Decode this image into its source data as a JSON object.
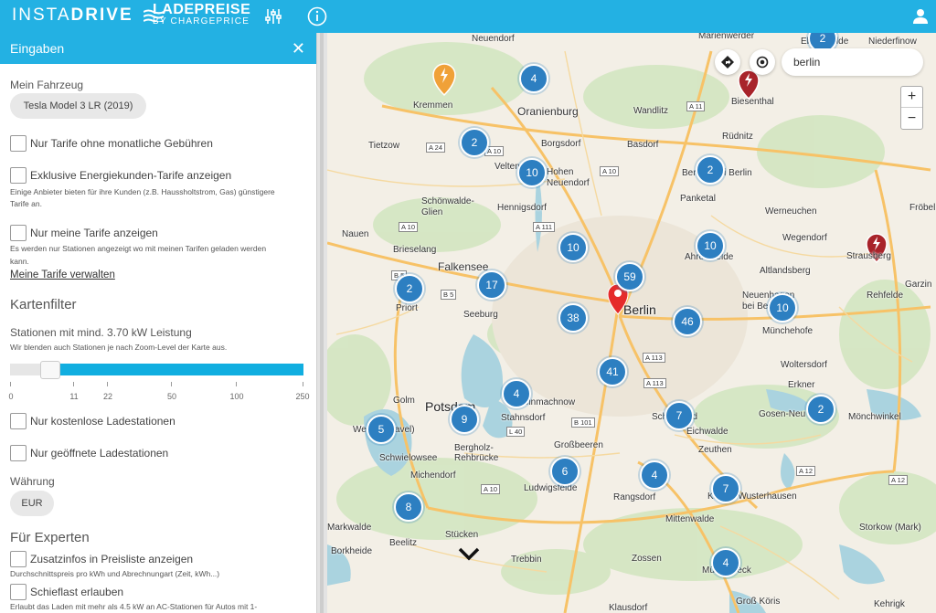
{
  "brand": {
    "insta_light": "INSTA",
    "insta_bold": "DRIVE",
    "lade_big": "LADEPREISE",
    "lade_small": "BY CHARGEPRICE"
  },
  "topbar": {
    "settings_icon": "sliders-icon",
    "info_icon": "info-icon",
    "user_icon": "user-icon"
  },
  "sidebar": {
    "title": "Eingaben",
    "vehicle_label": "Mein Fahrzeug",
    "vehicle_value": "Tesla Model 3 LR (2019)",
    "chk_no_monthly": "Nur Tarife ohne monatliche Gebühren",
    "chk_exclusive": "Exklusive Energiekunden-Tarife anzeigen",
    "hint_exclusive_1": "Einige Anbieter bieten für ihre Kunden (z.B. Haussholtstrom, Gas) günstigere",
    "hint_exclusive_2": "Tarife an.",
    "chk_my_tariffs": "Nur meine Tarife anzeigen",
    "hint_my_tariffs_1": "Es werden nur Stationen angezeigt wo mit meinen Tarifen geladen werden",
    "hint_my_tariffs_2": "kann.",
    "manage_link": "Meine Tarife verwalten",
    "map_filter_title": "Kartenfilter",
    "min_power_label": "Stationen mit mind. 3.70 kW Leistung",
    "min_power_hint": "Wir blenden auch Stationen je nach Zoom-Level der Karte aus.",
    "slider_ticks": [
      "0",
      "11",
      "22",
      "50",
      "100",
      "250"
    ],
    "slider_value_kw": 3.7,
    "chk_free": "Nur kostenlose Ladestationen",
    "chk_open": "Nur geöffnete Ladestationen",
    "currency_label": "Währung",
    "currency_value": "EUR",
    "experts_title": "Für Experten",
    "chk_extra_info": "Zusatzinfos in Preisliste anzeigen",
    "hint_extra_info": "Durchschnittspreis pro kWh und Abrechnungart (Zeit, kWh...)",
    "chk_unbalanced": "Schieflast erlauben",
    "hint_unbalanced": "Erlaubt das Laden mit mehr als 4.5 kW an AC-Stationen für Autos mit 1-"
  },
  "map": {
    "search_value": "berlin",
    "clusters": [
      "2",
      "4",
      "2",
      "10",
      "2",
      "10",
      "10",
      "59",
      "2",
      "17",
      "38",
      "46",
      "10",
      "41",
      "4",
      "2",
      "9",
      "7",
      "5",
      "6",
      "4",
      "7",
      "8",
      "4"
    ],
    "places": [
      "Marienwerder",
      "Neuendorf",
      "Oranienburg",
      "Wandlitz",
      "Biesenthal",
      "Rüdnitz",
      "Eberswalde",
      "Niederfinow",
      "Kremmen",
      "Tietzow",
      "Borgsdorf",
      "Basdorf",
      "Velten",
      "Hohen Neuendorf",
      "Bernau bei Berlin",
      "Panketal",
      "Schönwalde-Glien",
      "Hennigsdorf",
      "Werneuchen",
      "Nauen",
      "Wegendorf",
      "Fröbel",
      "Brieselang",
      "Falkensee",
      "Ahrensfelde",
      "Altlandsberg",
      "Strausberg",
      "Priort",
      "Seeburg",
      "Berlin",
      "Neuenhagen bei Berlin",
      "Rehfelde",
      "Garzin",
      "Münchehofe",
      "Woltersdorf",
      "Erkner",
      "Golm",
      "Potsdam",
      "Kleinmachnow",
      "Stahnsdorf",
      "Schönefeld",
      "Gosen-Neu Zittau",
      "Mönchwinkel",
      "Werder (Havel)",
      "Schwielowsee",
      "Bergholz-Rehbrücke",
      "Großbeeren",
      "Eichwalde",
      "Zeuthen",
      "Michendorf",
      "Ludwigsfelde",
      "Rangsdorf",
      "Königs Wusterhausen",
      "Mittenwalde",
      "Storkow (Mark)",
      "Beelitz",
      "Stücken",
      "Trebbin",
      "Zossen",
      "Borkheide",
      "Mühlenbeck",
      "Groß Köris",
      "Klausdorf",
      "Kehrigk",
      "Markwalde"
    ],
    "roads": [
      "A 24",
      "A 10",
      "A 11",
      "A 10",
      "A 111",
      "A 10",
      "B 5",
      "B 5",
      "A 113",
      "L 40",
      "B 101",
      "A 10",
      "A 12",
      "A 12",
      "A 113"
    ]
  }
}
